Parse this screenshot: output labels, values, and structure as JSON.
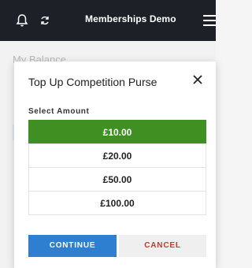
{
  "header": {
    "title": "Memberships Demo",
    "bg_color": "#1d2127",
    "icons": [
      "bell-icon",
      "sync-icon",
      "menu-icon"
    ]
  },
  "background": {
    "balance_label": "My Balance",
    "fragments": [
      "F",
      "Y",
      "T",
      "T"
    ]
  },
  "modal": {
    "title": "Top Up Competition Purse",
    "select_label": "Select Amount",
    "amounts": [
      "£10.00",
      "£20.00",
      "£50.00",
      "£100.00"
    ],
    "selected_index": 0,
    "continue_label": "CONTINUE",
    "cancel_label": "CANCEL",
    "colors": {
      "selected": "#3f8f22",
      "continue": "#2f7fd0",
      "cancel_text": "#c23a3a"
    }
  }
}
